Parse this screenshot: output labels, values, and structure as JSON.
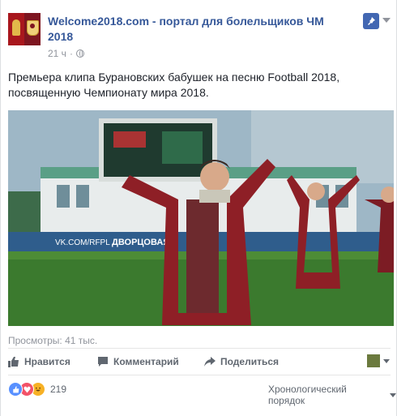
{
  "post": {
    "page_name": "Welcome2018.com - портал для болельщиков ЧМ 2018",
    "time": "21 ч",
    "separator": "·",
    "text": "Премьера клипа Бурановских бабушек на песню Football 2018, посвященную Чемпионату мира 2018.",
    "icons": [
      "page-avatar",
      "globe-icon",
      "pin-icon",
      "chevron-down-icon"
    ]
  },
  "video": {
    "scene": [
      "stadium",
      "grass-field",
      "scoreboard",
      "dancing-grannies"
    ],
    "banner_text": "VK.COM/RFPL",
    "banner_text2": "ДВОРЦОВАЯ"
  },
  "views": "Просмотры: 41 тыс.",
  "actions": {
    "like": "Нравится",
    "comment": "Комментарий",
    "share": "Поделиться"
  },
  "reactions": {
    "types": [
      "like",
      "love",
      "haha"
    ],
    "count": "219",
    "colors": {
      "like": "#5890ff",
      "love": "#f25268",
      "haha": "#f7b125"
    }
  },
  "sort": {
    "label": "Хронологический порядок"
  },
  "colors": {
    "link": "#365899",
    "meta": "#90949c",
    "pin_bg": "#4267b2"
  }
}
